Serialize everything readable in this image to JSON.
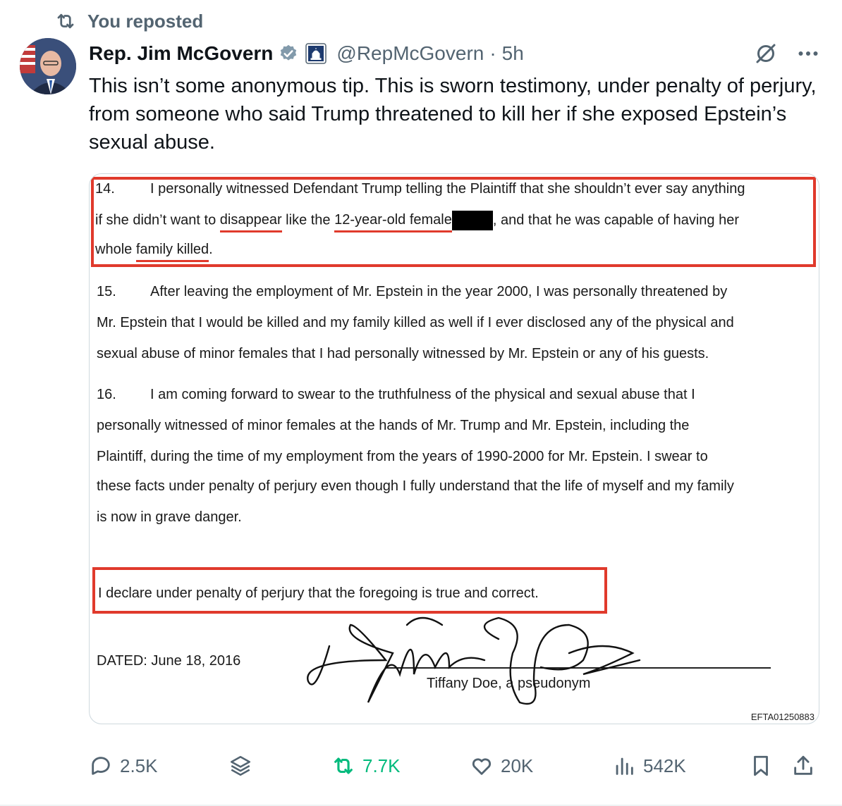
{
  "repost": {
    "label": "You reposted",
    "icon": "repost-icon"
  },
  "author": {
    "name": "Rep. Jim McGovern",
    "handle": "@RepMcGovern",
    "time": "5h",
    "verified_icon": "verified-badge-icon",
    "affiliation_icon": "capitol-badge-icon"
  },
  "tweet": {
    "text": "This isn’t some anonymous tip. This is sworn testimony, under penalty of perjury, from someone who said Trump threatened to kill her if she exposed Epstein’s sexual abuse."
  },
  "document": {
    "p14_num": "14.",
    "p14_l1": "I personally witnessed Defendant Trump telling the Plaintiff that she shouldn’t ever say anything",
    "p14_l2a": "if she didn’t want to ",
    "p14_l2_u1": "disappear",
    "p14_l2b": " like the ",
    "p14_l2_u2": "12-year-old female",
    "p14_l2c": ", and that he was capable of having her",
    "p14_l3a": "whole ",
    "p14_l3_u": "family killed",
    "p14_l3b": ".",
    "p15_num": "15.",
    "p15_l1": "After leaving the employment of Mr. Epstein in the year 2000, I was personally threatened by",
    "p15_l2": "Mr. Epstein that I would be killed and my family killed as well if I ever disclosed any of the physical and",
    "p15_l3": "sexual abuse of minor females that I had personally witnessed by Mr. Epstein or any of his guests.",
    "p16_num": "16.",
    "p16_l1": "I am coming forward to swear to the truthfulness of the physical and sexual abuse that I",
    "p16_l2": "personally witnessed of minor females at the hands of Mr. Trump and Mr. Epstein, including the",
    "p16_l3": "Plaintiff, during the time of my employment from the years of 1990-2000 for Mr. Epstein.  I swear to",
    "p16_l4": "these facts under penalty of perjury even though I fully understand that the life of myself and my family",
    "p16_l5": "is now in grave danger.",
    "declare": "I declare under penalty of perjury that the foregoing is true and correct.",
    "dated": "DATED:  June 18, 2016",
    "signer": "Tiffany Doe, a pseudonym",
    "doc_id": "EFTA01250883"
  },
  "actions": {
    "replies": "2.5K",
    "reposts": "7.7K",
    "likes": "20K",
    "views": "542K",
    "repost_color": "#00ba7c"
  },
  "colors": {
    "accent_red": "#e03a2c",
    "muted": "#536471",
    "verified": "#829aab"
  }
}
